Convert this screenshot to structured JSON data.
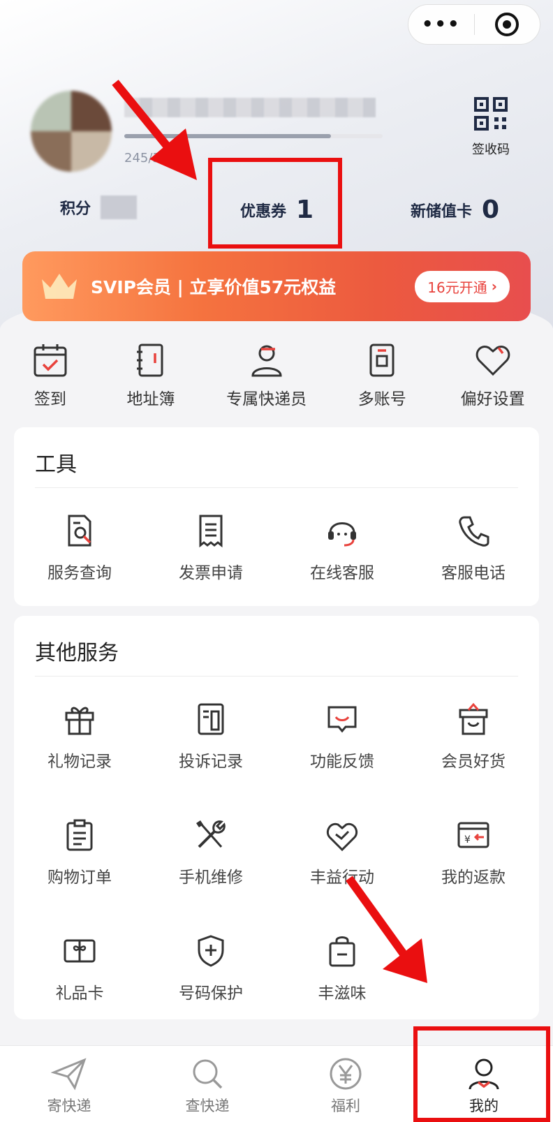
{
  "header": {
    "capsule": {
      "more_icon": "more-dots-icon",
      "close_icon": "target-icon",
      "dots": "•••"
    },
    "profile": {
      "progress_text": "245/30",
      "progress_fraction": 0.8
    },
    "qr": {
      "icon": "qr-code-icon",
      "label": "签收码"
    },
    "stats": [
      {
        "label": "积分",
        "value": ""
      },
      {
        "label": "优惠券",
        "value": "1"
      },
      {
        "label": "新储值卡",
        "value": "0"
      }
    ]
  },
  "svip": {
    "text": "SVIP会员 | 立享价值57元权益",
    "button": "16元开通",
    "chevron": "›"
  },
  "quick_actions": [
    {
      "label": "签到",
      "icon": "calendar-check-icon"
    },
    {
      "label": "地址簿",
      "icon": "address-book-icon"
    },
    {
      "label": "专属快递员",
      "icon": "courier-icon"
    },
    {
      "label": "多账号",
      "icon": "multi-account-icon"
    },
    {
      "label": "偏好设置",
      "icon": "heart-icon"
    }
  ],
  "tools": {
    "title": "工具",
    "items": [
      {
        "label": "服务查询",
        "icon": "service-search-icon"
      },
      {
        "label": "发票申请",
        "icon": "invoice-icon"
      },
      {
        "label": "在线客服",
        "icon": "headset-icon"
      },
      {
        "label": "客服电话",
        "icon": "phone-icon"
      }
    ]
  },
  "other_services": {
    "title": "其他服务",
    "items": [
      {
        "label": "礼物记录",
        "icon": "gift-icon"
      },
      {
        "label": "投诉记录",
        "icon": "complaint-record-icon"
      },
      {
        "label": "功能反馈",
        "icon": "feedback-icon"
      },
      {
        "label": "会员好货",
        "icon": "member-goods-icon"
      },
      {
        "label": "购物订单",
        "icon": "clipboard-icon"
      },
      {
        "label": "手机维修",
        "icon": "tools-icon"
      },
      {
        "label": "丰益行动",
        "icon": "charity-heart-icon"
      },
      {
        "label": "我的返款",
        "icon": "refund-icon"
      },
      {
        "label": "礼品卡",
        "icon": "gift-card-icon"
      },
      {
        "label": "号码保护",
        "icon": "shield-plus-icon"
      },
      {
        "label": "丰滋味",
        "icon": "shopping-bag-icon"
      }
    ]
  },
  "tabbar": [
    {
      "label": "寄快递",
      "icon": "send-icon",
      "active": false
    },
    {
      "label": "查快递",
      "icon": "search-icon",
      "active": false
    },
    {
      "label": "福利",
      "icon": "yuan-icon",
      "active": false
    },
    {
      "label": "我的",
      "icon": "profile-icon",
      "active": true
    }
  ],
  "colors": {
    "accent_red": "#e8423c",
    "annotation_red": "#ea0f10",
    "stat_text": "#1f2a44",
    "svip_gradient_start": "#ff9a5e",
    "svip_gradient_end": "#e84e4e"
  }
}
